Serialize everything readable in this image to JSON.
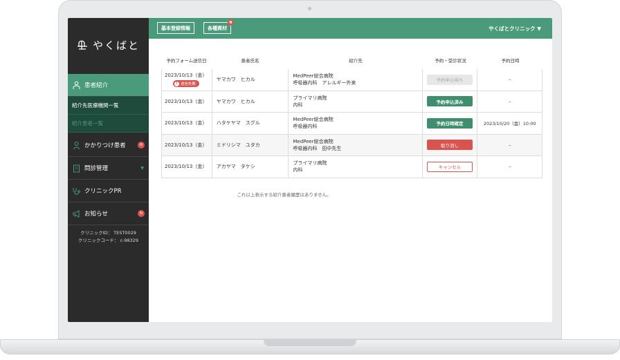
{
  "brand": {
    "name": "やくばと"
  },
  "sidebar": {
    "items": [
      {
        "label": "患者紹介",
        "icon": "patients-icon"
      },
      {
        "label": "紹介先医療機関一覧"
      },
      {
        "label": "紹介患者一覧"
      },
      {
        "label": "かかりつけ患者",
        "icon": "person-icon",
        "badge": "N"
      },
      {
        "label": "問診管理",
        "icon": "clipboard-icon",
        "caret": "▼"
      },
      {
        "label": "クリニックPR",
        "icon": "stethoscope-icon"
      },
      {
        "label": "お知らせ",
        "icon": "megaphone-icon",
        "badge": "N"
      }
    ],
    "clinic_id": "クリニックID： TEST0029",
    "clinic_code": "クリニックコード： c-98329"
  },
  "topbar": {
    "buttons": [
      {
        "label": "基本登録情報"
      },
      {
        "label": "各種資材",
        "badge": "N"
      }
    ],
    "clinic_menu": "やくばとクリニック ▼"
  },
  "table": {
    "headers": [
      "予約フォーム送信日",
      "患者氏名",
      "紹介先",
      "予約・受診状況",
      "予約日時"
    ],
    "rows": [
      {
        "date": "2023/10/13（金）",
        "fail": "送信失敗",
        "name": "ヤマカワ　ヒカル",
        "dest1": "MedPeer総合病院",
        "dest2": "呼吸器内科　アレルギー外来",
        "status": "予約申込待ち",
        "style": "st-grey",
        "datetime": "–"
      },
      {
        "date": "2023/10/13（金）",
        "fail": "",
        "name": "ヤマカワ　ヒカル",
        "dest1": "プライマリ病院",
        "dest2": "内科",
        "status": "予約申込済み",
        "style": "st-green",
        "datetime": "–"
      },
      {
        "date": "2023/10/13（金）",
        "fail": "",
        "name": "ハタケヤマ　スグル",
        "dest1": "MedPeer総合病院",
        "dest2": "呼吸器内科",
        "status": "予約日時確定",
        "style": "st-green",
        "datetime": "2023/10/20（金）10:00"
      },
      {
        "date": "2023/10/13（金）",
        "fail": "",
        "name": "ミドリシマ　ユタカ",
        "dest1": "MedPeer総合病院",
        "dest2": "呼吸器内科　田中先生",
        "status": "取り消し",
        "style": "st-red",
        "datetime": "–"
      },
      {
        "date": "2023/10/13（金）",
        "fail": "",
        "name": "アカヤマ　タケシ",
        "dest1": "プライマリ病院",
        "dest2": "内科",
        "status": "キャンセル",
        "style": "st-outline",
        "datetime": "–"
      }
    ],
    "no_more": "これ以上表示する紹介患者履歴はありません。"
  },
  "colors": {
    "accent": "#4a9a7c",
    "sidebar": "#2b2b2b",
    "danger": "#d9534f"
  }
}
